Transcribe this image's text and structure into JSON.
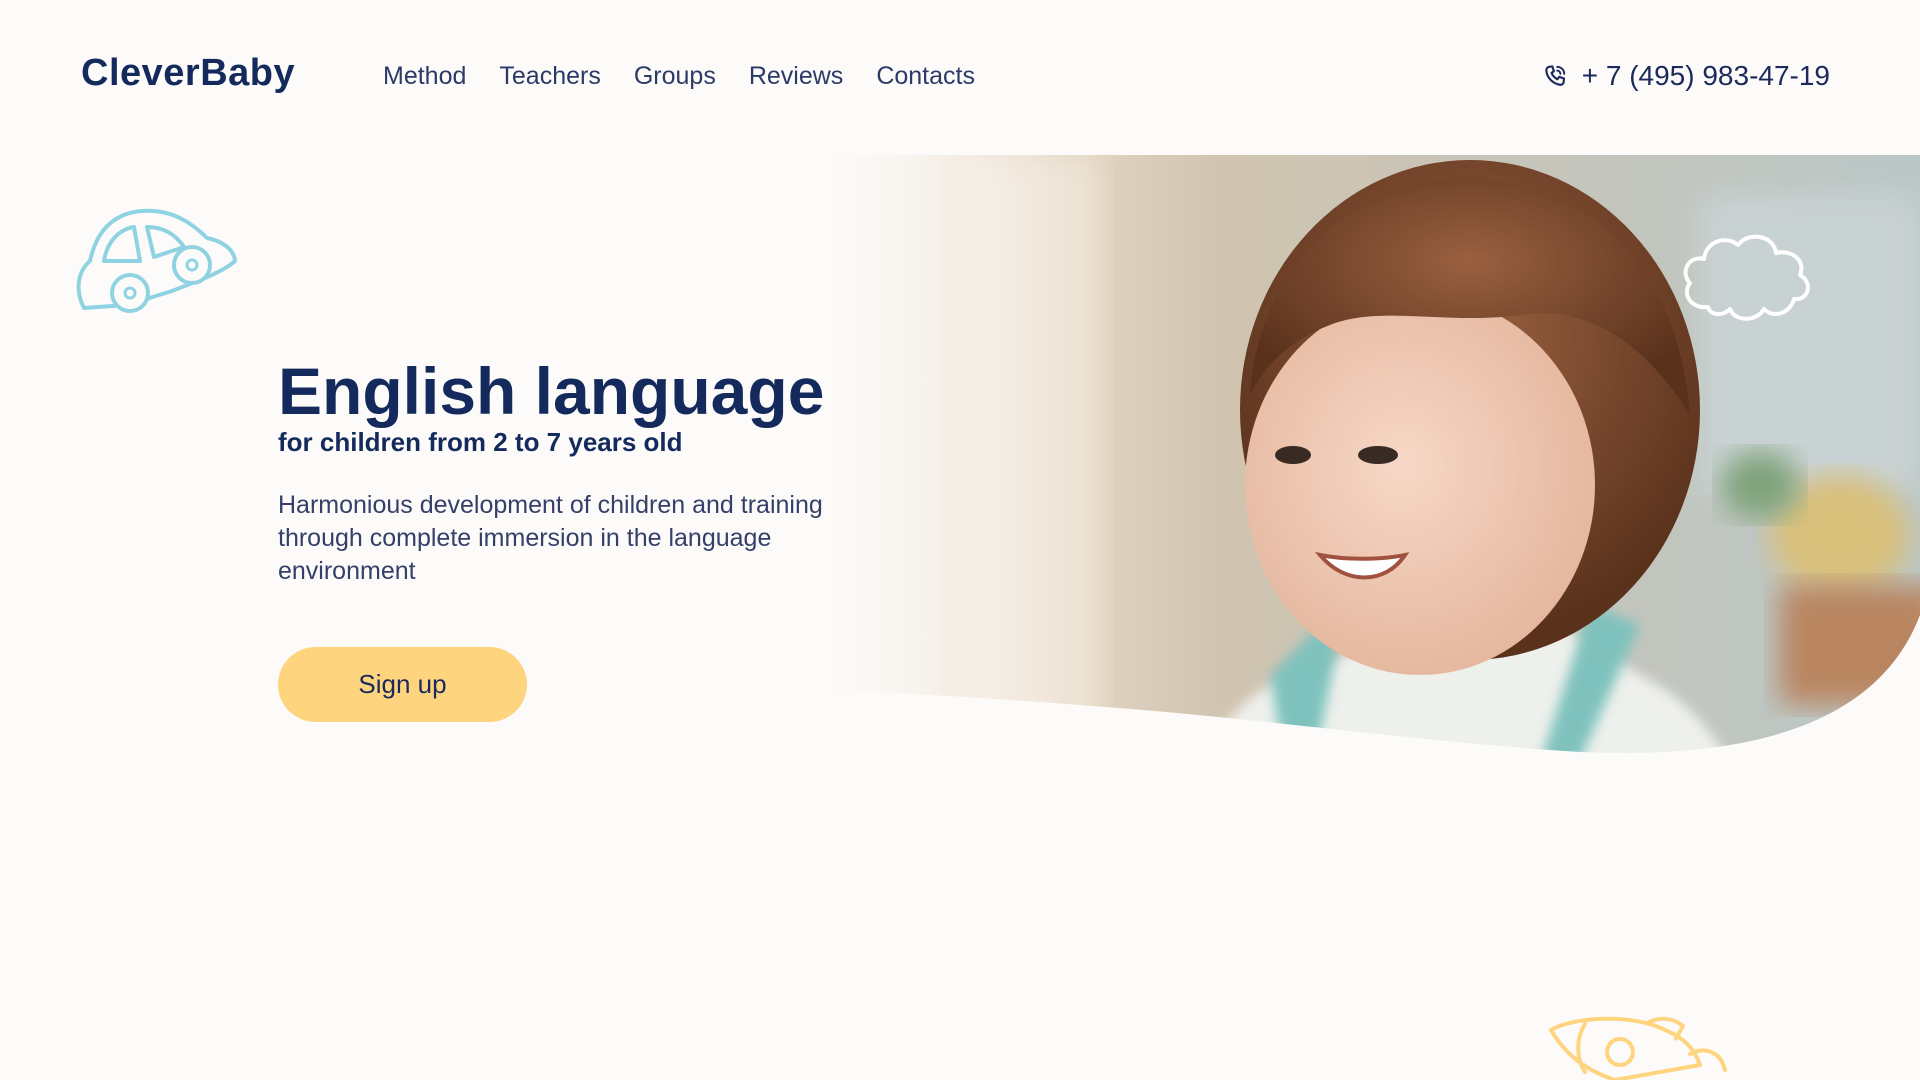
{
  "header": {
    "logo": "CleverBaby",
    "nav": [
      "Method",
      "Teachers",
      "Groups",
      "Reviews",
      "Contacts"
    ],
    "phone": "+ 7 (495) 983-47-19"
  },
  "hero": {
    "title": "English language",
    "subtitle": "for children from 2 to 7 years old",
    "description": "Harmonious development of children and training through complete immersion in the language environment",
    "cta_label": "Sign up"
  },
  "icons": {
    "car": "car-icon",
    "cloud": "cloud-icon",
    "rocket": "rocket-icon",
    "phone": "phone-icon"
  },
  "colors": {
    "background": "#fdfbf9",
    "text_primary": "#142a5c",
    "button": "#ffd47e",
    "car_outline": "#8fd3e2",
    "rocket_outline": "#ffd47e"
  }
}
